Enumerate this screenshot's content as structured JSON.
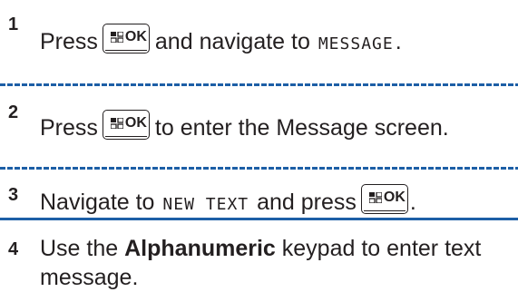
{
  "ok_key": {
    "label": "OK",
    "icon": "menu-grid-icon"
  },
  "steps": [
    {
      "number": "1",
      "text_before": "Press",
      "text_after": "and navigate to",
      "menu_item": "MESSAGE",
      "end": "."
    },
    {
      "number": "2",
      "text_before": "Press",
      "text_after": "to enter the Message screen."
    },
    {
      "number": "3",
      "text_before": "Navigate to",
      "menu_item": "NEW TEXT",
      "text_middle": "and press",
      "end": "."
    },
    {
      "number": "4",
      "text_before": "Use the",
      "bold_text": "Alphanumeric",
      "text_after": "keypad to enter text message."
    }
  ],
  "colors": {
    "separator": "#1d5fa6",
    "text": "#231f20"
  }
}
